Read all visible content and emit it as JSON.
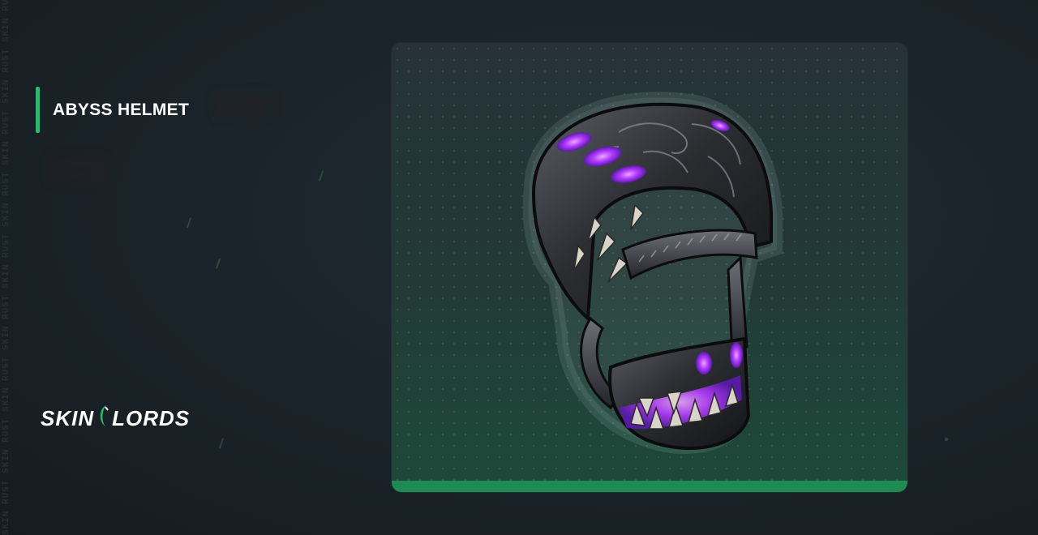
{
  "item": {
    "title": "ABYSS HELMET"
  },
  "watermark": {
    "text": "SKIN RUST SKIN RUST SKIN RUST SKIN RUST SKIN RUST SKIN RUST SKIN RUST SKIN RUST SKIN RUST SKIN"
  },
  "brand": {
    "part1": "SKIN",
    "part2": "LORDS"
  },
  "colors": {
    "accent_green": "#1fbf6b",
    "card_bar_green": "#1f8a52",
    "glow_purple": "#b53cff",
    "background": "#1a2329"
  },
  "icons": {
    "logo_mark": "crescent-glyph"
  }
}
